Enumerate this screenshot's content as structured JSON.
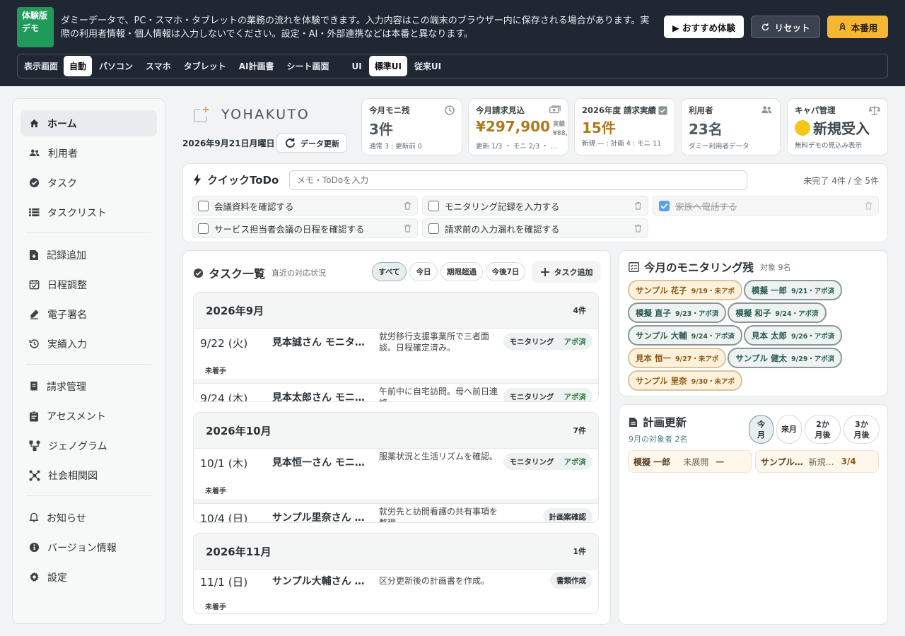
{
  "topbar": {
    "badge": "体験版デモ",
    "notice": "ダミーデータで、PC・スマホ・タブレットの業務の流れを体験できます。入力内容はこの端末のブラウザー内に保存される場合があります。実際の利用者情報・個人情報は入力しないでください。設定・AI・外部連携などは本番と異なります。",
    "recommend_label": "▶ おすすめ体験",
    "reset_label": "リセット",
    "prod_label": "本番用",
    "mode_label": "表示画面",
    "modes": [
      "自動",
      "パソコン",
      "スマホ",
      "タブレット",
      "AI計画書",
      "シート画面",
      "UI",
      "標準UI",
      "従来UI"
    ]
  },
  "sidebar": {
    "items": [
      {
        "label": "ホーム",
        "icon": "home-icon"
      },
      {
        "label": "利用者",
        "icon": "users-icon"
      },
      {
        "label": "タスク",
        "icon": "check-circle-icon"
      },
      {
        "label": "タスクリスト",
        "icon": "list-icon"
      },
      {
        "label": "記録追加",
        "icon": "doc-add-icon"
      },
      {
        "label": "日程調整",
        "icon": "calendar-check-icon"
      },
      {
        "label": "電子署名",
        "icon": "signature-icon"
      },
      {
        "label": "実績入力",
        "icon": "history-icon"
      },
      {
        "label": "請求管理",
        "icon": "billing-icon"
      },
      {
        "label": "アセスメント",
        "icon": "clipboard-icon"
      },
      {
        "label": "ジェノグラム",
        "icon": "genogram-icon"
      },
      {
        "label": "社会相関図",
        "icon": "network-icon"
      },
      {
        "label": "お知らせ",
        "icon": "bell-icon"
      },
      {
        "label": "バージョン情報",
        "icon": "info-icon"
      },
      {
        "label": "設定",
        "icon": "gear-icon"
      }
    ]
  },
  "header": {
    "logo": "YOHAKUTO",
    "date": "2026年9月21日月曜日",
    "refresh_label": "データ更新"
  },
  "stats": [
    {
      "label": "今月モニ残",
      "value": "3件",
      "sub": "通常 3 : 更新前 0",
      "icon": "clock-icon"
    },
    {
      "label": "今月請求見込",
      "value": "¥297,900",
      "side_top": "実績",
      "side_bottom": "¥88,40",
      "sub": "更新 1/3 ・ モニ 2/3 ・ …",
      "icon": "money-icon"
    },
    {
      "label": "2026年度 請求実績",
      "value": "15件",
      "sub": "新規 — : 計画 4 : モニ 11",
      "icon": "calendar-check-icon"
    },
    {
      "label": "利用者",
      "value": "23名",
      "sub": "ダミー利用者データ",
      "icon": "users-icon"
    },
    {
      "label": "キャパ管理",
      "value": "新規受入",
      "sub": "無料デモの見込み表示",
      "icon": "balance-icon",
      "status_color": "#f5c518"
    }
  ],
  "todo": {
    "title": "クイックToDo",
    "placeholder": "メモ・ToDoを入力",
    "count": "未完了 4件 / 全 5件",
    "items": [
      {
        "text": "会議資料を確認する",
        "done": false
      },
      {
        "text": "モニタリング記録を入力する",
        "done": false
      },
      {
        "text": "家族へ電話する",
        "done": true
      },
      {
        "text": "サービス担当者会議の日程を確認する",
        "done": false
      },
      {
        "text": "請求前の入力漏れを確認する",
        "done": false
      }
    ]
  },
  "tasks": {
    "title": "タスク一覧",
    "subtitle": "直近の対応状況",
    "filters": [
      "すべて",
      "今日",
      "期限超過",
      "今後7日"
    ],
    "add_label": "タスク追加",
    "months": [
      {
        "title": "2026年9月",
        "count": "4件",
        "rows": [
          {
            "date": "9/22 (火)",
            "name": "見本誠さん モニタリング",
            "note": "就労移行支援事業所で三者面談。日程確定済み。",
            "tag": "モニタリング",
            "tag2": "アポ済",
            "status": "未着手"
          },
          {
            "date": "9/24 (木)",
            "name": "見本太郎さん モニタリング",
            "note": "午前中に自宅訪問。母へ前日連絡。",
            "tag": "モニタリング",
            "tag2": "アポ済",
            "status": ""
          }
        ]
      },
      {
        "title": "2026年10月",
        "count": "7件",
        "rows": [
          {
            "date": "10/1 (木)",
            "name": "見本恒一さん モニタリング",
            "note": "服薬状況と生活リズムを確認。",
            "tag": "モニタリング",
            "tag2": "アポ済",
            "status": "未着手"
          },
          {
            "date": "10/4 (日)",
            "name": "サンプル里奈さん 計画案確認",
            "note": "就労先と訪問看護の共有事項を整理。",
            "tag": "計画案確認",
            "tag2": "",
            "status": ""
          }
        ]
      },
      {
        "title": "2026年11月",
        "count": "1件",
        "rows": [
          {
            "date": "11/1 (日)",
            "name": "サンプル大輔さん 書類作成",
            "note": "区分更新後の計画書を作成。",
            "tag": "書類作成",
            "tag2": "",
            "status": "未着手"
          }
        ]
      }
    ]
  },
  "monitoring": {
    "title": "今月のモニタリング残",
    "subtitle": "対象 9名",
    "chips": [
      {
        "name": "サンプル 花子",
        "detail": "9/19・未アポ",
        "state": "pending"
      },
      {
        "name": "模擬 一郎",
        "detail": "9/21・アポ済",
        "state": "booked"
      },
      {
        "name": "模擬 直子",
        "detail": "9/23・アポ済",
        "state": "booked"
      },
      {
        "name": "模擬 和子",
        "detail": "9/24・アポ済",
        "state": "booked"
      },
      {
        "name": "サンプル 大輔",
        "detail": "9/24・アポ済",
        "state": "booked"
      },
      {
        "name": "見本 太郎",
        "detail": "9/26・アポ済",
        "state": "booked"
      },
      {
        "name": "見本 恒一",
        "detail": "9/27・未アポ",
        "state": "pending"
      },
      {
        "name": "サンプル 健太",
        "detail": "9/29・アポ済",
        "state": "booked"
      },
      {
        "name": "サンプル 里奈",
        "detail": "9/30・未アポ",
        "state": "pending"
      }
    ]
  },
  "plan": {
    "title": "計画更新",
    "subtitle": "9月の対象者 2名",
    "periods": [
      "今月",
      "来月",
      "2か月後",
      "3か月後"
    ],
    "items": [
      {
        "name": "模擬 一郎",
        "state": "未展開",
        "value": "—"
      },
      {
        "name": "サンプル…",
        "state": "新規…",
        "value": "3/4"
      }
    ]
  }
}
